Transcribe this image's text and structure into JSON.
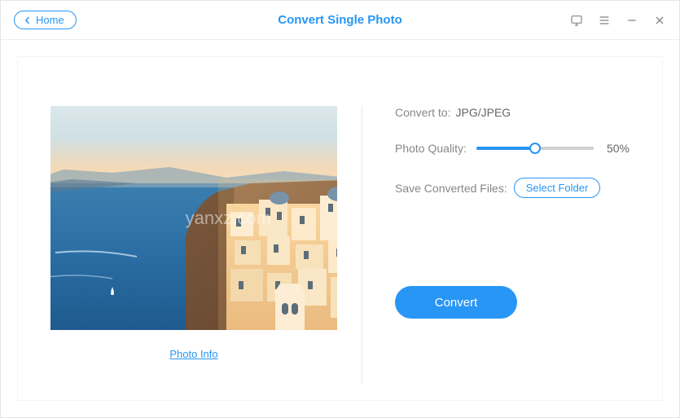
{
  "header": {
    "home_label": "Home",
    "title": "Convert Single Photo"
  },
  "left": {
    "photo_info_label": "Photo Info",
    "watermark": "yanxz.com"
  },
  "form": {
    "convert_to_label": "Convert to:",
    "convert_to_value": "JPG/JPEG",
    "quality_label": "Photo Quality:",
    "quality_value": "50%",
    "save_label": "Save Converted Files:",
    "select_folder_label": "Select Folder",
    "convert_button": "Convert"
  }
}
